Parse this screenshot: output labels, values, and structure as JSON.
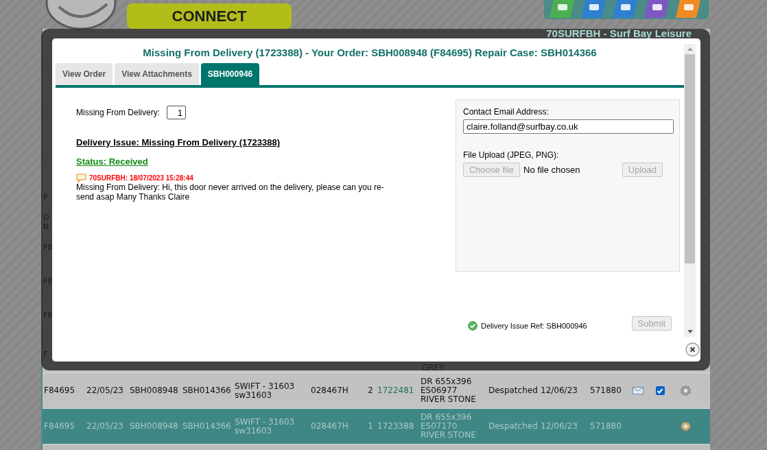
{
  "header": {
    "connect": "CONNECT",
    "account": "70SURFBH - Surf Bay Leisure"
  },
  "left_fragments": [
    "P",
    "O",
    "N",
    "F8",
    "F8",
    "F8",
    "F"
  ],
  "partial_row": {
    "description": "GREY"
  },
  "rows": [
    {
      "order": "F84695",
      "date": "22/05/23",
      "our_ref": "SBH008948",
      "repair": "SBH014366",
      "product": "SWIFT - 31603 sw31603",
      "code": "028467H",
      "qty": "2",
      "item": "1722481",
      "description": "DR 655x396 ES06977 RIVER STONE",
      "status": "Despatched",
      "despatch_date": "12/06/23",
      "delivery": "571880",
      "mail": true,
      "checked": true,
      "selected": false
    },
    {
      "order": "F84695",
      "date": "22/05/23",
      "our_ref": "SBH008948",
      "repair": "SBH014366",
      "product": "SWIFT - 31603 sw31603",
      "code": "028467H",
      "qty": "1",
      "item": "1723388",
      "description": "DR 655x396 ES07170 RIVER STONE",
      "status": "Despatched",
      "despatch_date": "12/06/23",
      "delivery": "571880",
      "mail": false,
      "selected": true
    }
  ],
  "modal": {
    "title": "Missing From Delivery (1723388) - Your Order: SBH008948 (F84695) Repair Case: SBH014366",
    "tabs": [
      {
        "label": "View Order",
        "selected": false
      },
      {
        "label": "View Attachments",
        "selected": false
      },
      {
        "label": "SBH000946",
        "selected": true
      }
    ],
    "missing_label": "Missing From Delivery:",
    "missing_qty": "1",
    "issue_heading": "Delivery Issue: Missing From Delivery (1723388)",
    "status": "Status: Received",
    "comment": {
      "author_time": "70SURFBH: 18/07/2023 15:28:44",
      "text": "Missing From Delivery: Hi, this door never arrived on the delivery, please can you re-send asap Many Thanks Claire"
    },
    "email_label": "Contact Email Address:",
    "email_value": "claire.folland@surfbay.co.uk",
    "upload_label": "File Upload (JPEG, PNG):",
    "choose_file": {
      "label": "Choose file",
      "disabled": true
    },
    "no_file": "No file chosen",
    "upload_button": {
      "label": "Upload",
      "disabled": true
    },
    "ref": "Delivery Issue Ref: SBH000946",
    "submit": {
      "label": "Submit",
      "disabled": true
    }
  }
}
